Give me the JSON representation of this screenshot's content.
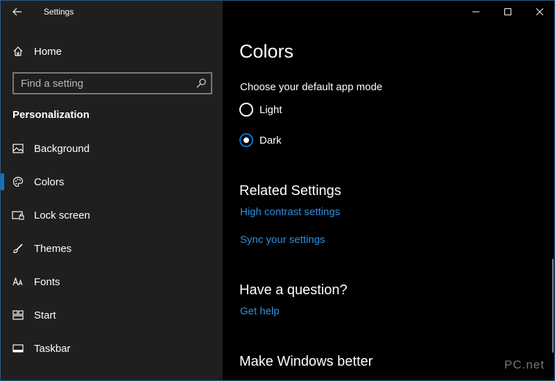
{
  "window": {
    "title": "Settings"
  },
  "sidebar": {
    "home_label": "Home",
    "search_placeholder": "Find a setting",
    "section_title": "Personalization",
    "items": [
      {
        "label": "Background",
        "icon": "image-icon",
        "active": false
      },
      {
        "label": "Colors",
        "icon": "palette-icon",
        "active": true
      },
      {
        "label": "Lock screen",
        "icon": "lock-screen-icon",
        "active": false
      },
      {
        "label": "Themes",
        "icon": "brush-icon",
        "active": false
      },
      {
        "label": "Fonts",
        "icon": "font-icon",
        "active": false
      },
      {
        "label": "Start",
        "icon": "start-icon",
        "active": false
      },
      {
        "label": "Taskbar",
        "icon": "taskbar-icon",
        "active": false
      }
    ]
  },
  "main": {
    "page_title": "Colors",
    "app_mode_label": "Choose your default app mode",
    "app_mode_options": [
      {
        "label": "Light",
        "selected": false
      },
      {
        "label": "Dark",
        "selected": true
      }
    ],
    "related_title": "Related Settings",
    "related_links": [
      "High contrast settings",
      "Sync your settings"
    ],
    "question_title": "Have a question?",
    "help_link": "Get help",
    "better_title": "Make Windows better"
  },
  "watermark": "PC.net",
  "colors": {
    "accent": "#0078d7",
    "link": "#2d8fe0",
    "sidebar_bg": "#1f1f1f",
    "main_bg": "#000000"
  }
}
